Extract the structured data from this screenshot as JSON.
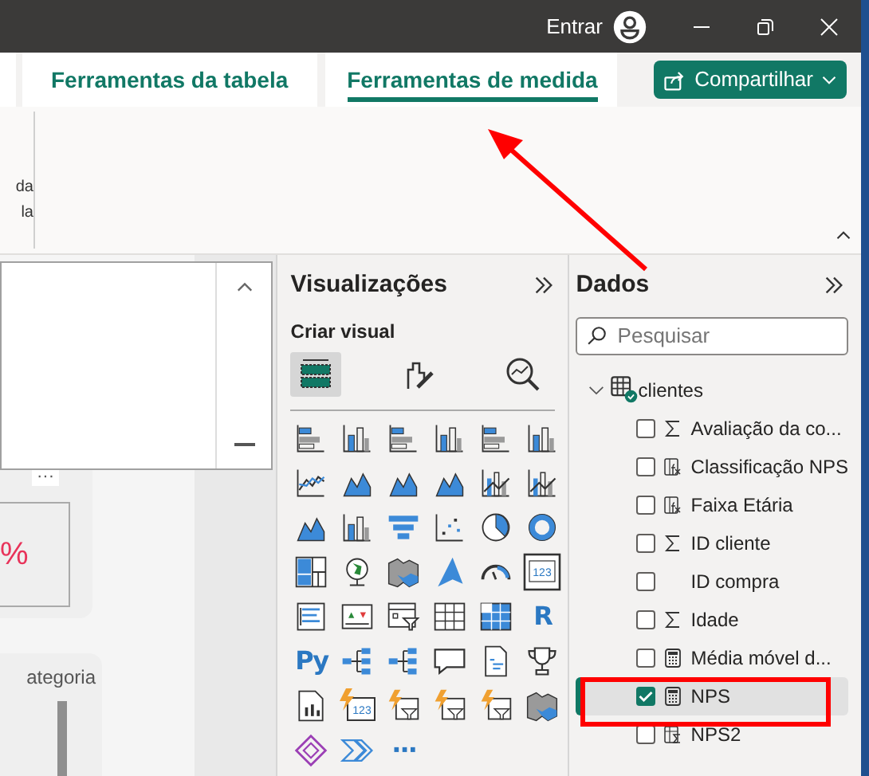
{
  "title_bar": {
    "sign_in": "Entrar"
  },
  "ribbon": {
    "tabs": [
      {
        "label": "Ferramentas da tabela",
        "selected": false
      },
      {
        "label": "Ferramentas de medida",
        "selected": true
      }
    ],
    "share_button": "Compartilhar",
    "cut_lines": [
      "da",
      "la"
    ]
  },
  "canvas": {
    "more": "···",
    "kpi_value": "%",
    "card_title": "ategoria"
  },
  "visualizations": {
    "title": "Visualizações",
    "subtitle": "Criar visual",
    "modes": [
      {
        "kind": "build",
        "selected": true
      },
      {
        "kind": "format",
        "selected": false
      },
      {
        "kind": "analytics",
        "selected": false
      }
    ],
    "gallery": [
      {
        "kind": "hbar"
      },
      {
        "kind": "vbar"
      },
      {
        "kind": "hbar"
      },
      {
        "kind": "vbar"
      },
      {
        "kind": "hbar"
      },
      {
        "kind": "vbar"
      },
      {
        "kind": "line"
      },
      {
        "kind": "area"
      },
      {
        "kind": "area"
      },
      {
        "kind": "area"
      },
      {
        "kind": "combo"
      },
      {
        "kind": "combo"
      },
      {
        "kind": "area"
      },
      {
        "kind": "vbar"
      },
      {
        "kind": "funnel"
      },
      {
        "kind": "scatter"
      },
      {
        "kind": "pie"
      },
      {
        "kind": "donut"
      },
      {
        "kind": "treemap"
      },
      {
        "kind": "globe"
      },
      {
        "kind": "map"
      },
      {
        "kind": "arrowhead"
      },
      {
        "kind": "gauge"
      },
      {
        "kind": "card",
        "label": "123"
      },
      {
        "kind": "list"
      },
      {
        "kind": "kpi"
      },
      {
        "kind": "slicer"
      },
      {
        "kind": "table"
      },
      {
        "kind": "matrix"
      },
      {
        "kind": "text",
        "label": "R"
      },
      {
        "kind": "text",
        "label": "Py"
      },
      {
        "kind": "tree"
      },
      {
        "kind": "tree"
      },
      {
        "kind": "speech"
      },
      {
        "kind": "doc"
      },
      {
        "kind": "trophy"
      },
      {
        "kind": "report"
      },
      {
        "kind": "bolt",
        "label": "123"
      },
      {
        "kind": "bolt"
      },
      {
        "kind": "bolt"
      },
      {
        "kind": "bolt"
      },
      {
        "kind": "map"
      },
      {
        "kind": "diamond"
      },
      {
        "kind": "chevrons"
      },
      {
        "kind": "text",
        "label": "···"
      }
    ]
  },
  "data_pane": {
    "title": "Dados",
    "search": {
      "placeholder": "Pesquisar"
    },
    "tables": [
      {
        "name": "clientes",
        "expanded": true,
        "children": [
          {
            "name": "Avaliação da co...",
            "kind": "sum",
            "checked": false,
            "selected": false
          },
          {
            "name": "Classificação NPS",
            "kind": "calc-column",
            "checked": false,
            "selected": false
          },
          {
            "name": "Faixa Etária",
            "kind": "calc-column",
            "checked": false,
            "selected": false
          },
          {
            "name": "ID cliente",
            "kind": "sum",
            "checked": false,
            "selected": false
          },
          {
            "name": "ID compra",
            "kind": "plain",
            "checked": false,
            "selected": false
          },
          {
            "name": "Idade",
            "kind": "sum",
            "checked": false,
            "selected": false
          },
          {
            "name": "Média móvel d...",
            "kind": "measure",
            "checked": false,
            "selected": false
          },
          {
            "name": "NPS",
            "kind": "measure",
            "checked": true,
            "selected": true
          },
          {
            "name": "NPS2",
            "kind": "calc-table",
            "checked": false,
            "selected": false
          }
        ]
      }
    ]
  }
}
